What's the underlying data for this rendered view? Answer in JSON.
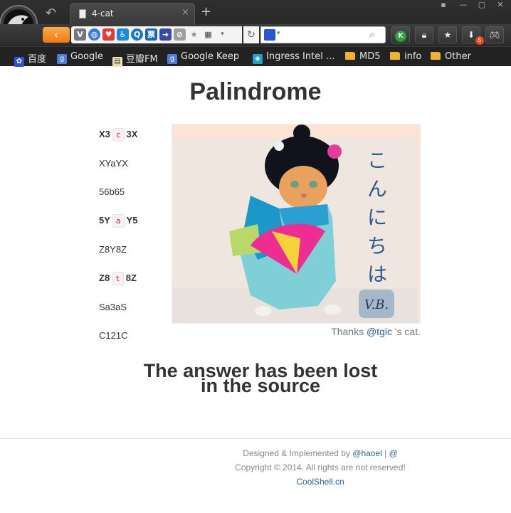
{
  "browser": {
    "tab_title": "4-cat",
    "tab_close": "×",
    "new_tab": "+",
    "back_symbol": "‹",
    "window_buttons": [
      "▪",
      "—",
      "▢",
      "✕"
    ],
    "nav_buttons": [
      "K",
      "lock-icon",
      "star-icon",
      "download-icon",
      "gamepad-icon"
    ],
    "download_count": "5",
    "accent": "#f08a1a"
  },
  "bookmarks": [
    {
      "label": "百度",
      "icon": "paw-icon"
    },
    {
      "label": "Google",
      "icon": "google-icon"
    },
    {
      "label": "豆瓣FM",
      "icon": "doubanfm-icon"
    },
    {
      "label": "Google Keep",
      "icon": "google-icon"
    },
    {
      "label": "Ingress Intel ...",
      "icon": "ingress-icon"
    },
    {
      "label": "MD5",
      "icon": "folder-icon"
    },
    {
      "label": "info",
      "icon": "folder-icon"
    },
    {
      "label": "Other",
      "icon": "folder-icon"
    }
  ],
  "page": {
    "title": "Palindrome",
    "palindromes": [
      {
        "left": "X3",
        "code": "c",
        "right": "3X"
      },
      {
        "text": "XYaYX"
      },
      {
        "text": "56b65"
      },
      {
        "left": "5Y",
        "code": "a",
        "right": "Y5"
      },
      {
        "text": "Z8Y8Z"
      },
      {
        "left": "Z8",
        "code": "t",
        "right": "8Z"
      },
      {
        "text": "Sa3aS"
      },
      {
        "text": "C121C"
      }
    ],
    "image": {
      "japanese_text": "こんにちは",
      "signature": "V.B."
    },
    "caption": {
      "prefix": "Thanks ",
      "link": "@tgic",
      "suffix": " 's cat."
    },
    "answer_line1": "The answer has been lost",
    "answer_line2": "in the source"
  },
  "footer": {
    "designed_prefix": "Designed & Implemented by ",
    "designer": "@haoel",
    "separator": " | ",
    "at": "@",
    "copyright": "Copyright © 2014. All rights are not reserved!",
    "site": "CoolShell.cn"
  }
}
